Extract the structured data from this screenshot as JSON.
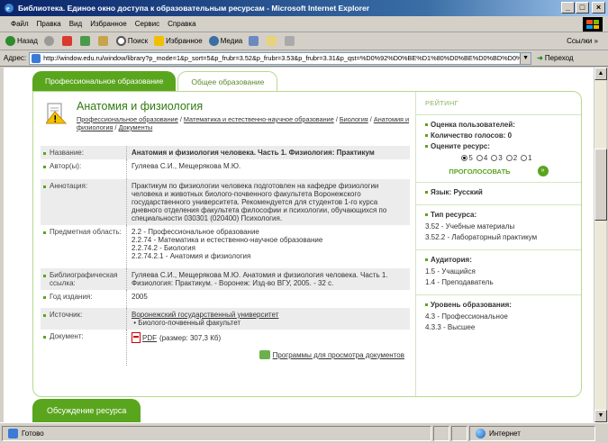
{
  "window": {
    "title": "Библиотека. Единое окно доступа к образовательным ресурсам - Microsoft Internet Explorer",
    "controls": [
      "_",
      "□",
      "×"
    ]
  },
  "menu": [
    "Файл",
    "Правка",
    "Вид",
    "Избранное",
    "Сервис",
    "Справка"
  ],
  "toolbar": {
    "back": "Назад",
    "search": "Поиск",
    "favorites": "Избранное",
    "media": "Медиа",
    "links": "Ссылки"
  },
  "address": {
    "label": "Адрес:",
    "url": "http://window.edu.ru/window/library?p_mode=1&p_sort=5&p_frubr=3.52&p_frubr=3.53&p_frubr=3.31&p_qst=%D0%92%D0%BE%D1%80%D0%BE%D0%BD%D0%",
    "go": "Переход"
  },
  "tabs": {
    "active": "Профессиональное образование",
    "inactive": "Общее образование"
  },
  "resource": {
    "title": "Анатомия и физиология",
    "crumbs": [
      "Профессиональное образование",
      "Математика и естественно-научное образование",
      "Биология",
      "Анатомия и физиология",
      "Документы"
    ],
    "crumb_sep": " / "
  },
  "fields": {
    "name_label": "Название:",
    "name_value": "Анатомия и физиология человека. Часть 1. Физиология: Практикум",
    "authors_label": "Автор(ы):",
    "authors_value": "Гуляева С.И., Мещерякова М.Ю.",
    "annotation_label": "Аннотация:",
    "annotation_value": "Практикум по физиологии человека подготовлен на кафедре физиологии человека и животных биолого-почвенного факультета Воронежского государственного университета. Рекомендуется для студентов 1-го курса дневного отделения факультета философии и психологии, обучающихся по специальности 030301 (020400) Психология.",
    "subject_label": "Предметная область:",
    "subject_items": [
      "2.2 - Профессиональное образование",
      "2.2.74 - Математика и естественно-научное образование",
      "2.2.74.2 - Биология",
      "2.2.74.2.1 - Анатомия и физиология"
    ],
    "biblio_label": "Библиографическая ссылка:",
    "biblio_value": "Гуляева С.И., Мещерякова М.Ю. Анатомия и физиология человека. Часть 1. Физиология: Практикум. - Воронеж: Изд-во ВГУ, 2005. - 32 с.",
    "year_label": "Год издания:",
    "year_value": "2005",
    "source_label": "Источник:",
    "source_link": "Воронежский государственный университет",
    "source_sub": "Биолого-почвенный факультет",
    "doc_label": "Документ:",
    "doc_link": "PDF",
    "doc_size": "(размер: 307,3 Кб)",
    "programs_link": "Программы для просмотра документов"
  },
  "sidebar": {
    "rating_head": "РЕЙТИНГ",
    "user_rating": "Оценка пользователей:",
    "votes": "Количество голосов: 0",
    "rate_prompt": "Оцените ресурс:",
    "options": [
      "5",
      "4",
      "3",
      "2",
      "1"
    ],
    "selected": "5",
    "vote_button": "ПРОГОЛОСОВАТЬ",
    "vote_go": "»",
    "language": "Язык: Русский",
    "type_head": "Тип ресурса:",
    "type_items": [
      "3.52 - Учебные материалы",
      "3.52.2 - Лабораторный практикум"
    ],
    "audience_head": "Аудитория:",
    "audience_items": [
      "1.5 - Учащийся",
      "1.4 - Преподаватель"
    ],
    "level_head": "Уровень образования:",
    "level_items": [
      "4.3 - Профессиональное",
      "4.3.3 - Высшее"
    ]
  },
  "discussion_tab": "Обсуждение ресурса",
  "status": {
    "text": "Готово",
    "zone": "Интернет"
  }
}
